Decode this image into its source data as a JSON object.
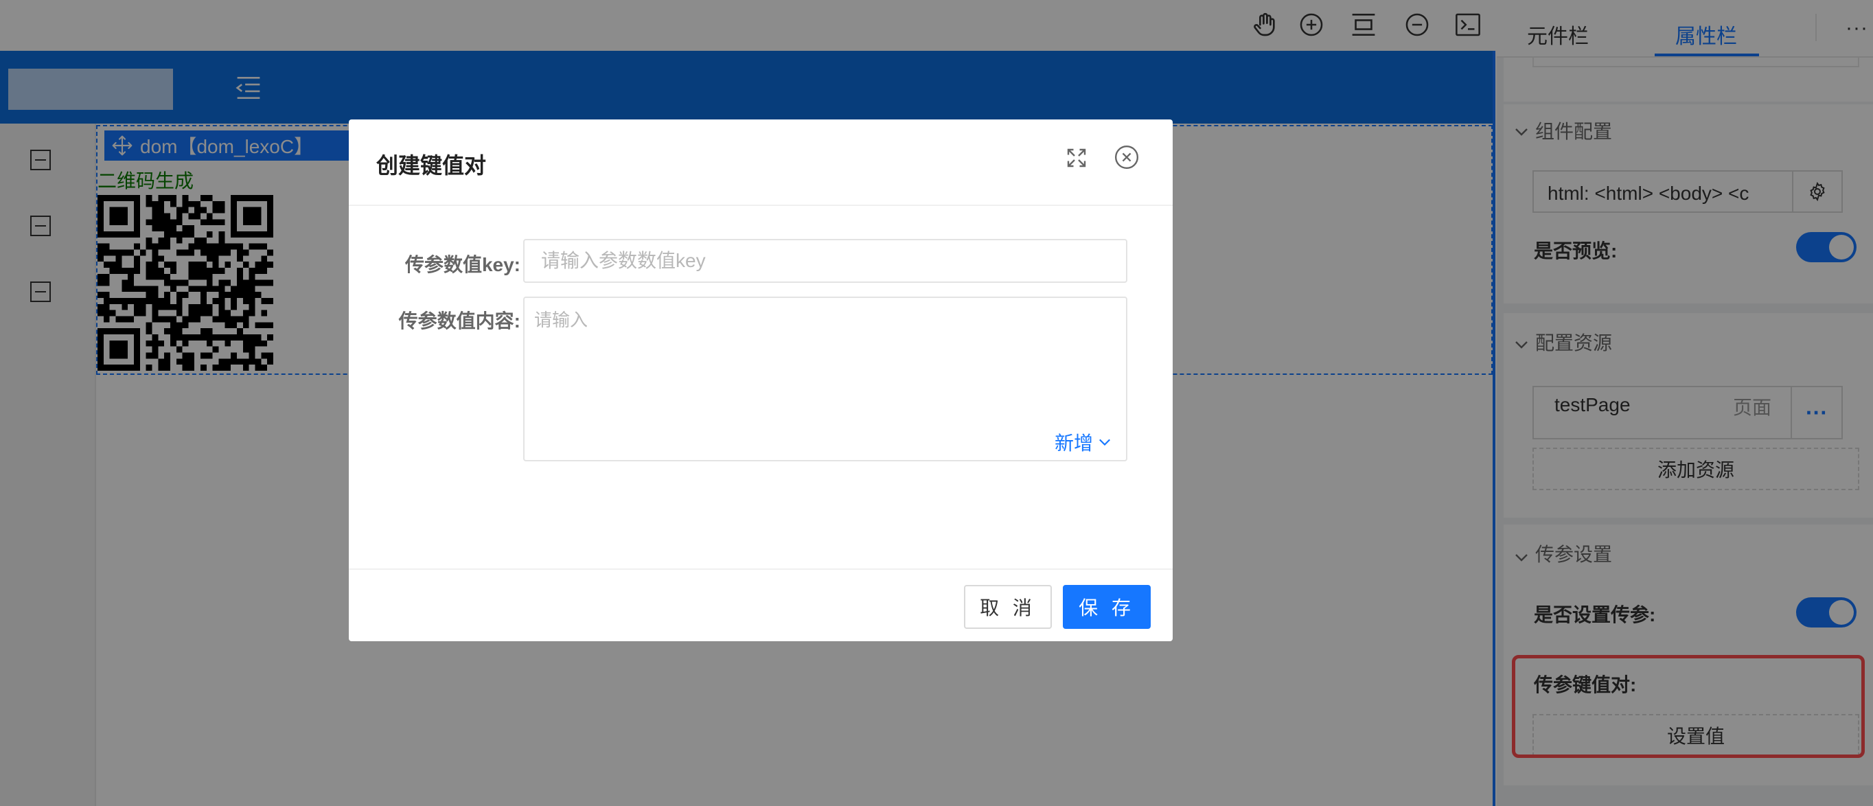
{
  "toolbar": {
    "icons": [
      "hand-icon",
      "zoom-in-icon",
      "fit-icon",
      "zoom-out-icon",
      "terminal-icon"
    ]
  },
  "canvas": {
    "dom_tag": "dom【dom_lexoC】",
    "qr_title": "二维码生成"
  },
  "panel": {
    "tabs": [
      {
        "label": "元件栏",
        "active": false
      },
      {
        "label": "属性栏",
        "active": true
      }
    ],
    "more": "···",
    "component_config": {
      "title": "组件配置",
      "html_value": "html: <html>  <body>    <c",
      "preview_label": "是否预览:",
      "preview_on": true
    },
    "resources": {
      "title": "配置资源",
      "item_name": "testPage",
      "item_type": "页面",
      "more": "···",
      "add_label": "添加资源"
    },
    "params": {
      "title": "传参设置",
      "enable_label": "是否设置传参:",
      "enable_on": true,
      "kv_label": "传参键值对:",
      "set_label": "设置值"
    }
  },
  "modal": {
    "title": "创建键值对",
    "key_label": "传参数值key:",
    "key_placeholder": "请输入参数数值key",
    "key_value": "",
    "content_label": "传参数值内容:",
    "content_placeholder": "请输入",
    "add_label": "新增",
    "cancel_label": "取 消",
    "save_label": "保 存"
  },
  "colors": {
    "primary": "#1677ff",
    "header_blue": "#0d6fe0",
    "highlight": "#ff4d4f",
    "qr_title": "#0a7d00"
  }
}
